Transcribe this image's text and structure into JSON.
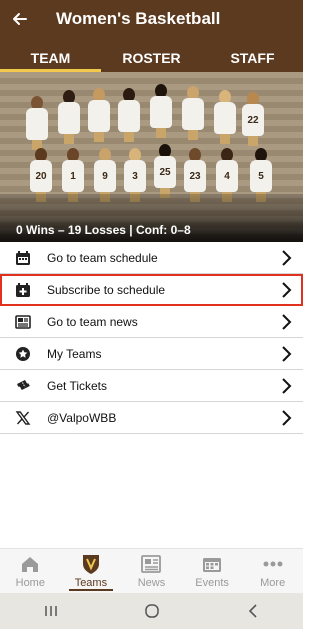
{
  "header": {
    "title": "Women's Basketball",
    "tabs": [
      {
        "label": "TEAM",
        "active": true
      },
      {
        "label": "ROSTER",
        "active": false
      },
      {
        "label": "STAFF",
        "active": false
      }
    ]
  },
  "photo": {
    "record": "0 Wins – 19 Losses | Conf: 0–8",
    "jersey_numbers": [
      "20",
      "1",
      "9",
      "3",
      "25",
      "23",
      "4",
      "5",
      "22"
    ]
  },
  "list": {
    "items": [
      {
        "label": "Go to team schedule",
        "icon": "calendar-icon"
      },
      {
        "label": "Subscribe to schedule",
        "icon": "calendar-add-icon"
      },
      {
        "label": "Go to team news",
        "icon": "news-icon"
      },
      {
        "label": "My Teams",
        "icon": "star-badge-icon"
      },
      {
        "label": "Get Tickets",
        "icon": "ticket-icon"
      },
      {
        "label": "@ValpoWBB",
        "icon": "x-logo-icon"
      }
    ]
  },
  "nav": {
    "items": [
      {
        "label": "Home",
        "icon": "home-icon",
        "active": false
      },
      {
        "label": "Teams",
        "icon": "teams-logo-icon",
        "active": true
      },
      {
        "label": "News",
        "icon": "news-icon",
        "active": false
      },
      {
        "label": "Events",
        "icon": "calendar-icon",
        "active": false
      },
      {
        "label": "More",
        "icon": "more-dots-icon",
        "active": false
      }
    ]
  },
  "colors": {
    "brand": "#5b3a1f",
    "accent": "#f2c94c",
    "highlight": "#e0301e"
  }
}
